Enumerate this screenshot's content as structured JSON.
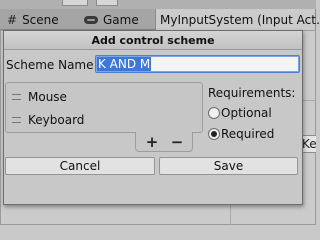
{
  "tabs": [
    {
      "label": "Scene",
      "icon": "grid-icon"
    },
    {
      "label": "Game",
      "icon": "gamepad-icon"
    },
    {
      "label": "MyInputSystem (Input Act…",
      "icon": ""
    }
  ],
  "background": {
    "partial_button_label": "Ke"
  },
  "dialog": {
    "title": "Add control scheme",
    "scheme_name_label": "Scheme Name",
    "scheme_name_value": "K AND M",
    "devices": [
      "Mouse",
      "Keyboard"
    ],
    "add_device_symbol": "+",
    "remove_device_symbol": "−",
    "requirements_label": "Requirements:",
    "requirement_options": [
      {
        "label": "Optional",
        "selected": false
      },
      {
        "label": "Required",
        "selected": true
      }
    ],
    "cancel_label": "Cancel",
    "save_label": "Save"
  }
}
